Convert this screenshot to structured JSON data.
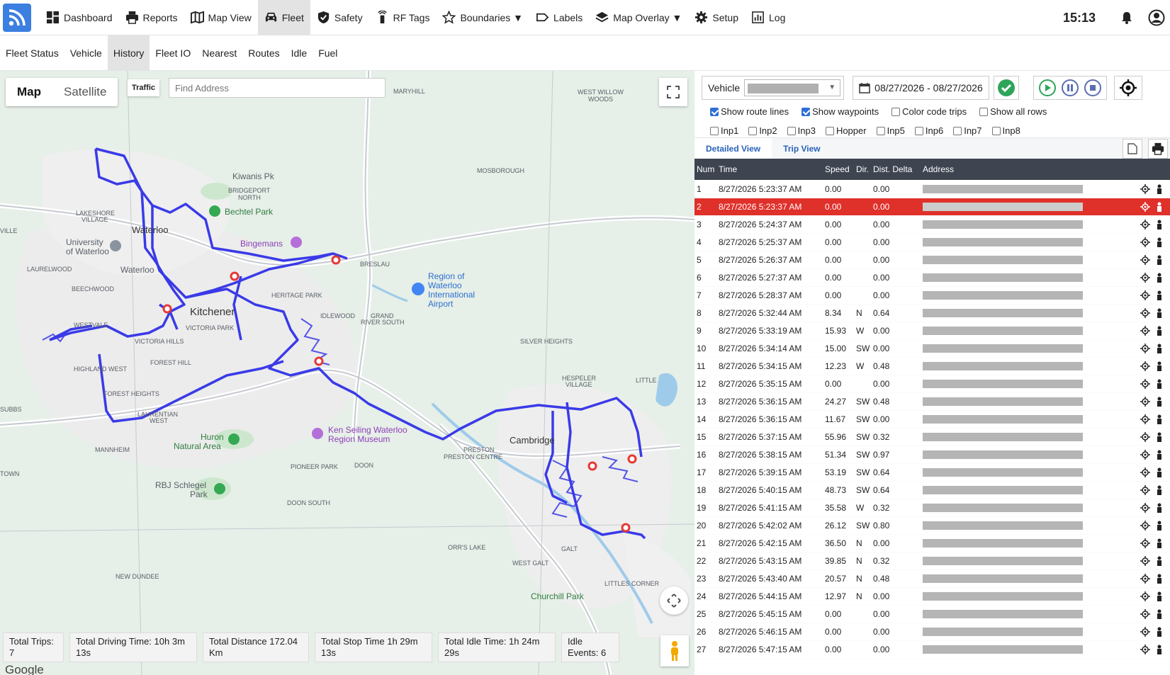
{
  "nav": {
    "items": [
      {
        "label": "Dashboard",
        "icon": "dashboard-icon"
      },
      {
        "label": "Reports",
        "icon": "printer-icon"
      },
      {
        "label": "Map View",
        "icon": "map-icon"
      },
      {
        "label": "Fleet",
        "icon": "car-icon",
        "active": true
      },
      {
        "label": "Safety",
        "icon": "shield-icon"
      },
      {
        "label": "RF Tags",
        "icon": "rf-tag-icon"
      },
      {
        "label": "Boundaries ▼",
        "icon": "star-icon"
      },
      {
        "label": "Labels",
        "icon": "label-icon"
      },
      {
        "label": "Map Overlay ▼",
        "icon": "layers-icon"
      },
      {
        "label": "Setup",
        "icon": "gear-icon"
      },
      {
        "label": "Log",
        "icon": "chart-icon"
      }
    ],
    "clock": "15:13"
  },
  "subnav": {
    "items": [
      {
        "label": "Fleet Status"
      },
      {
        "label": "Vehicle"
      },
      {
        "label": "History",
        "active": true
      },
      {
        "label": "Fleet IO"
      },
      {
        "label": "Nearest"
      },
      {
        "label": "Routes"
      },
      {
        "label": "Idle"
      },
      {
        "label": "Fuel"
      }
    ]
  },
  "map": {
    "type_map": "Map",
    "type_satellite": "Satellite",
    "traffic": "Traffic",
    "find_placeholder": "Find Address",
    "attribution": "Google",
    "labels": {
      "maryhill": "MARYHILL",
      "westwillow1": "WEST WILLOW",
      "westwillow2": "WOODS",
      "kiwanis": "Kiwanis Pk",
      "bridgeport1": "BRIDGEPORT",
      "bridgeport2": "NORTH",
      "mosborough": "MOSBOROUGH",
      "lakeshore1": "LAKESHORE",
      "lakeshore2": "VILLAGE",
      "bechtel": "Bechtel Park",
      "waterloo": "Waterloo",
      "uw1": "University",
      "uw2": "of Waterloo",
      "bingemans": "Bingemans",
      "breslau": "BRESLAU",
      "laurelwood": "LAURELWOOD",
      "waterloo2": "Waterloo",
      "airport1": "Region of",
      "airport2": "Waterloo",
      "airport3": "International",
      "airport4": "Airport",
      "beechwood": "BEECHWOOD",
      "heritage": "HERITAGE PARK",
      "kitchener": "Kitchener",
      "idlewood": "IDLEWOOD",
      "grand1": "GRAND",
      "grand2": "RIVER SOUTH",
      "westvale": "WESTVALE",
      "victoriapark": "VICTORIA PARK",
      "victoriahills": "VICTORIA HILLS",
      "silverheights": "SILVER HEIGHTS",
      "foresthill": "FOREST HILL",
      "highlandwest": "HIGHLAND WEST",
      "hespeler1": "HESPELER",
      "hespeler2": "VILLAGE",
      "forestheights": "FOREST HEIGHTS",
      "laurentian1": "LAURENTIAN",
      "laurentian2": "WEST",
      "subbs": "SUBBS",
      "huron1": "Huron",
      "huron2": "Natural Area",
      "kenseiling1": "Ken Seiling Waterloo",
      "kenseiling2": "Region Museum",
      "cambridge": "Cambridge",
      "mannheim": "MANNHEIM",
      "preston": "PRESTON",
      "prestoncentre": "PRESTON CENTRE",
      "pioneer": "PIONEER PARK",
      "doon": "DOON",
      "rbj1": "RBJ Schlegel",
      "rbj2": "Park",
      "doonsouth": "DOON SOUTH",
      "orrslake": "ORR'S LAKE",
      "galt": "GALT",
      "westgalt": "WEST GALT",
      "newdundee": "NEW DUNDEE",
      "churchill": "Churchill Park",
      "littles": "LITTLES CORNER",
      "ville": "VILLE",
      "town": "TOWN",
      "little": "LITTLE"
    },
    "stats": [
      "Total Trips: 7",
      "Total Driving Time: 10h 3m 13s",
      "Total Distance 172.04 Km",
      "Total Stop Time 1h 29m 13s",
      "Total Idle Time: 1h 24m 29s",
      "Idle Events: 6"
    ]
  },
  "panel": {
    "vehicle_label": "Vehicle",
    "date_range": "08/27/2026 - 08/27/2026",
    "options": [
      {
        "label": "Show route lines",
        "checked": true
      },
      {
        "label": "Show waypoints",
        "checked": true
      },
      {
        "label": "Color code trips",
        "checked": false
      },
      {
        "label": "Show all rows",
        "checked": false
      }
    ],
    "inputs": [
      "Inp1",
      "Inp2",
      "Inp3",
      "Hopper",
      "Inp5",
      "Inp6",
      "Inp7",
      "Inp8"
    ],
    "tabs": [
      {
        "label": "Detailed View",
        "active": true
      },
      {
        "label": "Trip View"
      }
    ],
    "columns": [
      "Num",
      "Time",
      "Speed",
      "Dir.",
      "Dist. Delta",
      "Address"
    ],
    "rows": [
      {
        "num": "1",
        "time": "8/27/2026 5:23:37 AM",
        "speed": "0.00",
        "dir": "",
        "dist": "0.00"
      },
      {
        "num": "2",
        "time": "8/27/2026 5:23:37 AM",
        "speed": "0.00",
        "dir": "",
        "dist": "0.00",
        "selected": true
      },
      {
        "num": "3",
        "time": "8/27/2026 5:24:37 AM",
        "speed": "0.00",
        "dir": "",
        "dist": "0.00"
      },
      {
        "num": "4",
        "time": "8/27/2026 5:25:37 AM",
        "speed": "0.00",
        "dir": "",
        "dist": "0.00"
      },
      {
        "num": "5",
        "time": "8/27/2026 5:26:37 AM",
        "speed": "0.00",
        "dir": "",
        "dist": "0.00"
      },
      {
        "num": "6",
        "time": "8/27/2026 5:27:37 AM",
        "speed": "0.00",
        "dir": "",
        "dist": "0.00"
      },
      {
        "num": "7",
        "time": "8/27/2026 5:28:37 AM",
        "speed": "0.00",
        "dir": "",
        "dist": "0.00"
      },
      {
        "num": "8",
        "time": "8/27/2026 5:32:44 AM",
        "speed": "8.34",
        "dir": "N",
        "dist": "0.64"
      },
      {
        "num": "9",
        "time": "8/27/2026 5:33:19 AM",
        "speed": "15.93",
        "dir": "W",
        "dist": "0.00"
      },
      {
        "num": "10",
        "time": "8/27/2026 5:34:14 AM",
        "speed": "15.00",
        "dir": "SW",
        "dist": "0.00"
      },
      {
        "num": "11",
        "time": "8/27/2026 5:34:15 AM",
        "speed": "12.23",
        "dir": "W",
        "dist": "0.48"
      },
      {
        "num": "12",
        "time": "8/27/2026 5:35:15 AM",
        "speed": "0.00",
        "dir": "",
        "dist": "0.00"
      },
      {
        "num": "13",
        "time": "8/27/2026 5:36:15 AM",
        "speed": "24.27",
        "dir": "SW",
        "dist": "0.48"
      },
      {
        "num": "14",
        "time": "8/27/2026 5:36:15 AM",
        "speed": "11.67",
        "dir": "SW",
        "dist": "0.00"
      },
      {
        "num": "15",
        "time": "8/27/2026 5:37:15 AM",
        "speed": "55.96",
        "dir": "SW",
        "dist": "0.32"
      },
      {
        "num": "16",
        "time": "8/27/2026 5:38:15 AM",
        "speed": "51.34",
        "dir": "SW",
        "dist": "0.97"
      },
      {
        "num": "17",
        "time": "8/27/2026 5:39:15 AM",
        "speed": "53.19",
        "dir": "SW",
        "dist": "0.64"
      },
      {
        "num": "18",
        "time": "8/27/2026 5:40:15 AM",
        "speed": "48.73",
        "dir": "SW",
        "dist": "0.64"
      },
      {
        "num": "19",
        "time": "8/27/2026 5:41:15 AM",
        "speed": "35.58",
        "dir": "W",
        "dist": "0.32"
      },
      {
        "num": "20",
        "time": "8/27/2026 5:42:02 AM",
        "speed": "26.12",
        "dir": "SW",
        "dist": "0.80"
      },
      {
        "num": "21",
        "time": "8/27/2026 5:42:15 AM",
        "speed": "36.50",
        "dir": "N",
        "dist": "0.00"
      },
      {
        "num": "22",
        "time": "8/27/2026 5:43:15 AM",
        "speed": "39.85",
        "dir": "N",
        "dist": "0.32"
      },
      {
        "num": "23",
        "time": "8/27/2026 5:43:40 AM",
        "speed": "20.57",
        "dir": "N",
        "dist": "0.48"
      },
      {
        "num": "24",
        "time": "8/27/2026 5:44:15 AM",
        "speed": "12.97",
        "dir": "N",
        "dist": "0.00"
      },
      {
        "num": "25",
        "time": "8/27/2026 5:45:15 AM",
        "speed": "0.00",
        "dir": "",
        "dist": "0.00"
      },
      {
        "num": "26",
        "time": "8/27/2026 5:46:15 AM",
        "speed": "0.00",
        "dir": "",
        "dist": "0.00"
      },
      {
        "num": "27",
        "time": "8/27/2026 5:47:15 AM",
        "speed": "0.00",
        "dir": "",
        "dist": "0.00"
      }
    ]
  },
  "colors": {
    "route": "#3a3ae8",
    "selected_row": "#e0302a",
    "header_bg": "#3e4450",
    "accent": "#3b7fe0",
    "waypoint": "#e53935"
  }
}
